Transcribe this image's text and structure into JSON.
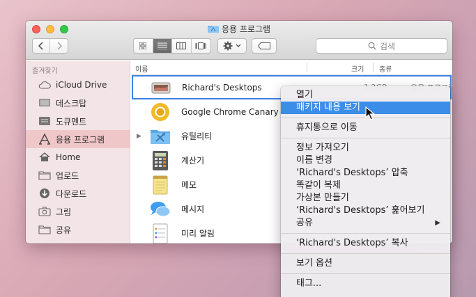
{
  "window": {
    "title": "응용 프로그램",
    "search_placeholder": "검색"
  },
  "sidebar": {
    "header": "즐겨찾기",
    "items": [
      {
        "label": "iCloud Drive",
        "icon": "cloud-icon"
      },
      {
        "label": "데스크탑",
        "icon": "desktop-icon"
      },
      {
        "label": "도큐멘트",
        "icon": "document-icon"
      },
      {
        "label": "응용 프로그램",
        "icon": "applications-icon",
        "selected": true
      },
      {
        "label": "Home",
        "icon": "home-icon"
      },
      {
        "label": "업로드",
        "icon": "folder-icon"
      },
      {
        "label": "다운로드",
        "icon": "download-icon"
      },
      {
        "label": "그림",
        "icon": "camera-icon"
      },
      {
        "label": "공유",
        "icon": "folder-icon"
      }
    ]
  },
  "columns": {
    "name": "이름",
    "size": "크기",
    "kind": "종류"
  },
  "files": [
    {
      "name": "Richard's Desktops",
      "size": "1.2GB",
      "kind": "응용 프로그램",
      "icon": "richards-desktops-app-icon",
      "selected": true
    },
    {
      "name": "Google Chrome Canary",
      "icon": "chrome-canary-icon"
    },
    {
      "name": "유틸리티",
      "icon": "utilities-folder-icon",
      "expandable": true
    },
    {
      "name": "계산기",
      "icon": "calculator-icon"
    },
    {
      "name": "메모",
      "icon": "notes-icon"
    },
    {
      "name": "메시지",
      "icon": "messages-icon"
    },
    {
      "name": "미리 알림",
      "icon": "reminders-icon"
    }
  ],
  "context_menu": {
    "open": "열기",
    "show_package": "패키지 내용 보기",
    "move_to_trash": "휴지통으로 이동",
    "get_info": "정보 가져오기",
    "rename": "이름 변경",
    "compress": "‘Richard's Desktops’ 압축",
    "duplicate": "똑같이 복제",
    "make_alias": "가상본 만들기",
    "quick_look": "‘Richard's Desktops’ 훑어보기",
    "share": "공유",
    "copy": "‘Richard's Desktops’ 복사",
    "view_options": "보기 옵션",
    "tags": "태그..."
  },
  "colors": {
    "sidebar_selected": "#f0c7c8",
    "menu_highlight": "#3b8de8",
    "selection_outline": "#3a82e6"
  }
}
